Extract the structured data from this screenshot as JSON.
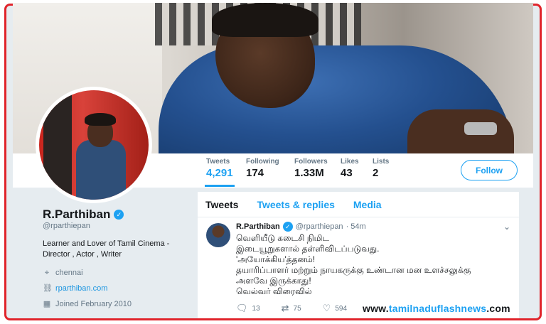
{
  "profile": {
    "name": "R.Parthiban",
    "handle": "@rparthiepan",
    "bio": "Learner and Lover of Tamil Cinema - Director , Actor , Writer",
    "location": "chennai",
    "website": "rparthiban.com",
    "joined": "Joined February 2010"
  },
  "stats": [
    {
      "label": "Tweets",
      "value": "4,291",
      "active": true
    },
    {
      "label": "Following",
      "value": "174"
    },
    {
      "label": "Followers",
      "value": "1.33M"
    },
    {
      "label": "Likes",
      "value": "43"
    },
    {
      "label": "Lists",
      "value": "2"
    }
  ],
  "follow_label": "Follow",
  "tabs": [
    "Tweets",
    "Tweets & replies",
    "Media"
  ],
  "tweet": {
    "name": "R.Parthiban",
    "handle": "@rparthiepan",
    "time": "· 54m",
    "lines": [
      "வெளியீடு கடைசி நிமிட",
      "இடையூறுகளால் தள்ளிவிடப்படுவது.",
      "'அயோக்கிய'த்தனம்!",
      "தயாரிப்பாளர் மற்றும் நாயகருக்கு உண்டான மன உளச்சலுக்கு",
      "அளவே இருக்காது!",
      "வெல்வர் விரைவில்"
    ],
    "replies": "13",
    "retweets": "75",
    "likes": "594"
  },
  "watermark": {
    "prefix": "www.",
    "highlight": "tamilnaduflashnews",
    "suffix": ".com"
  },
  "colors": {
    "accent": "#1da1f2",
    "frame": "#e0242b",
    "background": "#e6ecf0"
  }
}
